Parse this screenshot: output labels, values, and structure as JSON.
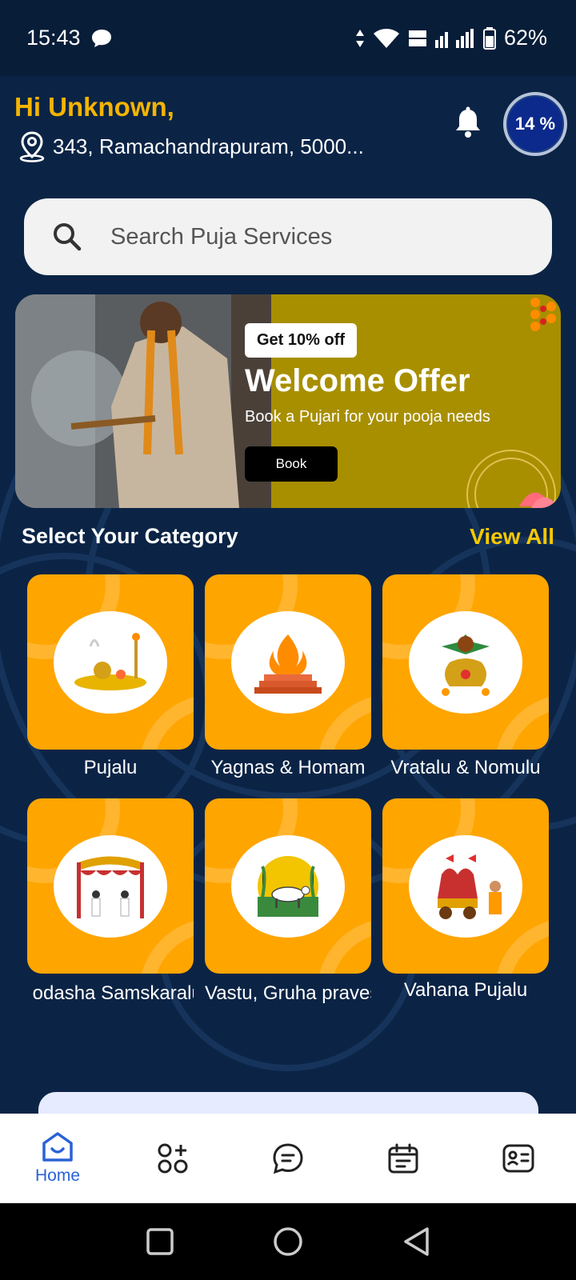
{
  "status_bar": {
    "time": "15:43",
    "battery": "62%"
  },
  "header": {
    "greeting": "Hi Unknown,",
    "location": "343, Ramachandrapuram, 5000...",
    "progress": "14 %"
  },
  "search": {
    "placeholder": "Search Puja Services"
  },
  "banner": {
    "chip": "Get 10% off",
    "title": "Welcome Offer",
    "subtitle": "Book a Pujari for your pooja needs",
    "button": "Book"
  },
  "categories": {
    "title": "Select Your Category",
    "view_all": "View All",
    "items": [
      {
        "label": "Pujalu"
      },
      {
        "label": "Yagnas & Homam"
      },
      {
        "label": "Vratalu & Nomulu"
      },
      {
        "label": " odasha Samskaralu"
      },
      {
        "label": "Vastu, Gruha praves"
      },
      {
        "label": "Vahana Pujalu"
      }
    ]
  },
  "bottom_nav": {
    "home": "Home"
  },
  "colors": {
    "background": "#0b2446",
    "accent": "#f4b400",
    "card": "#ffa500",
    "nav_active": "#2a62d6"
  }
}
